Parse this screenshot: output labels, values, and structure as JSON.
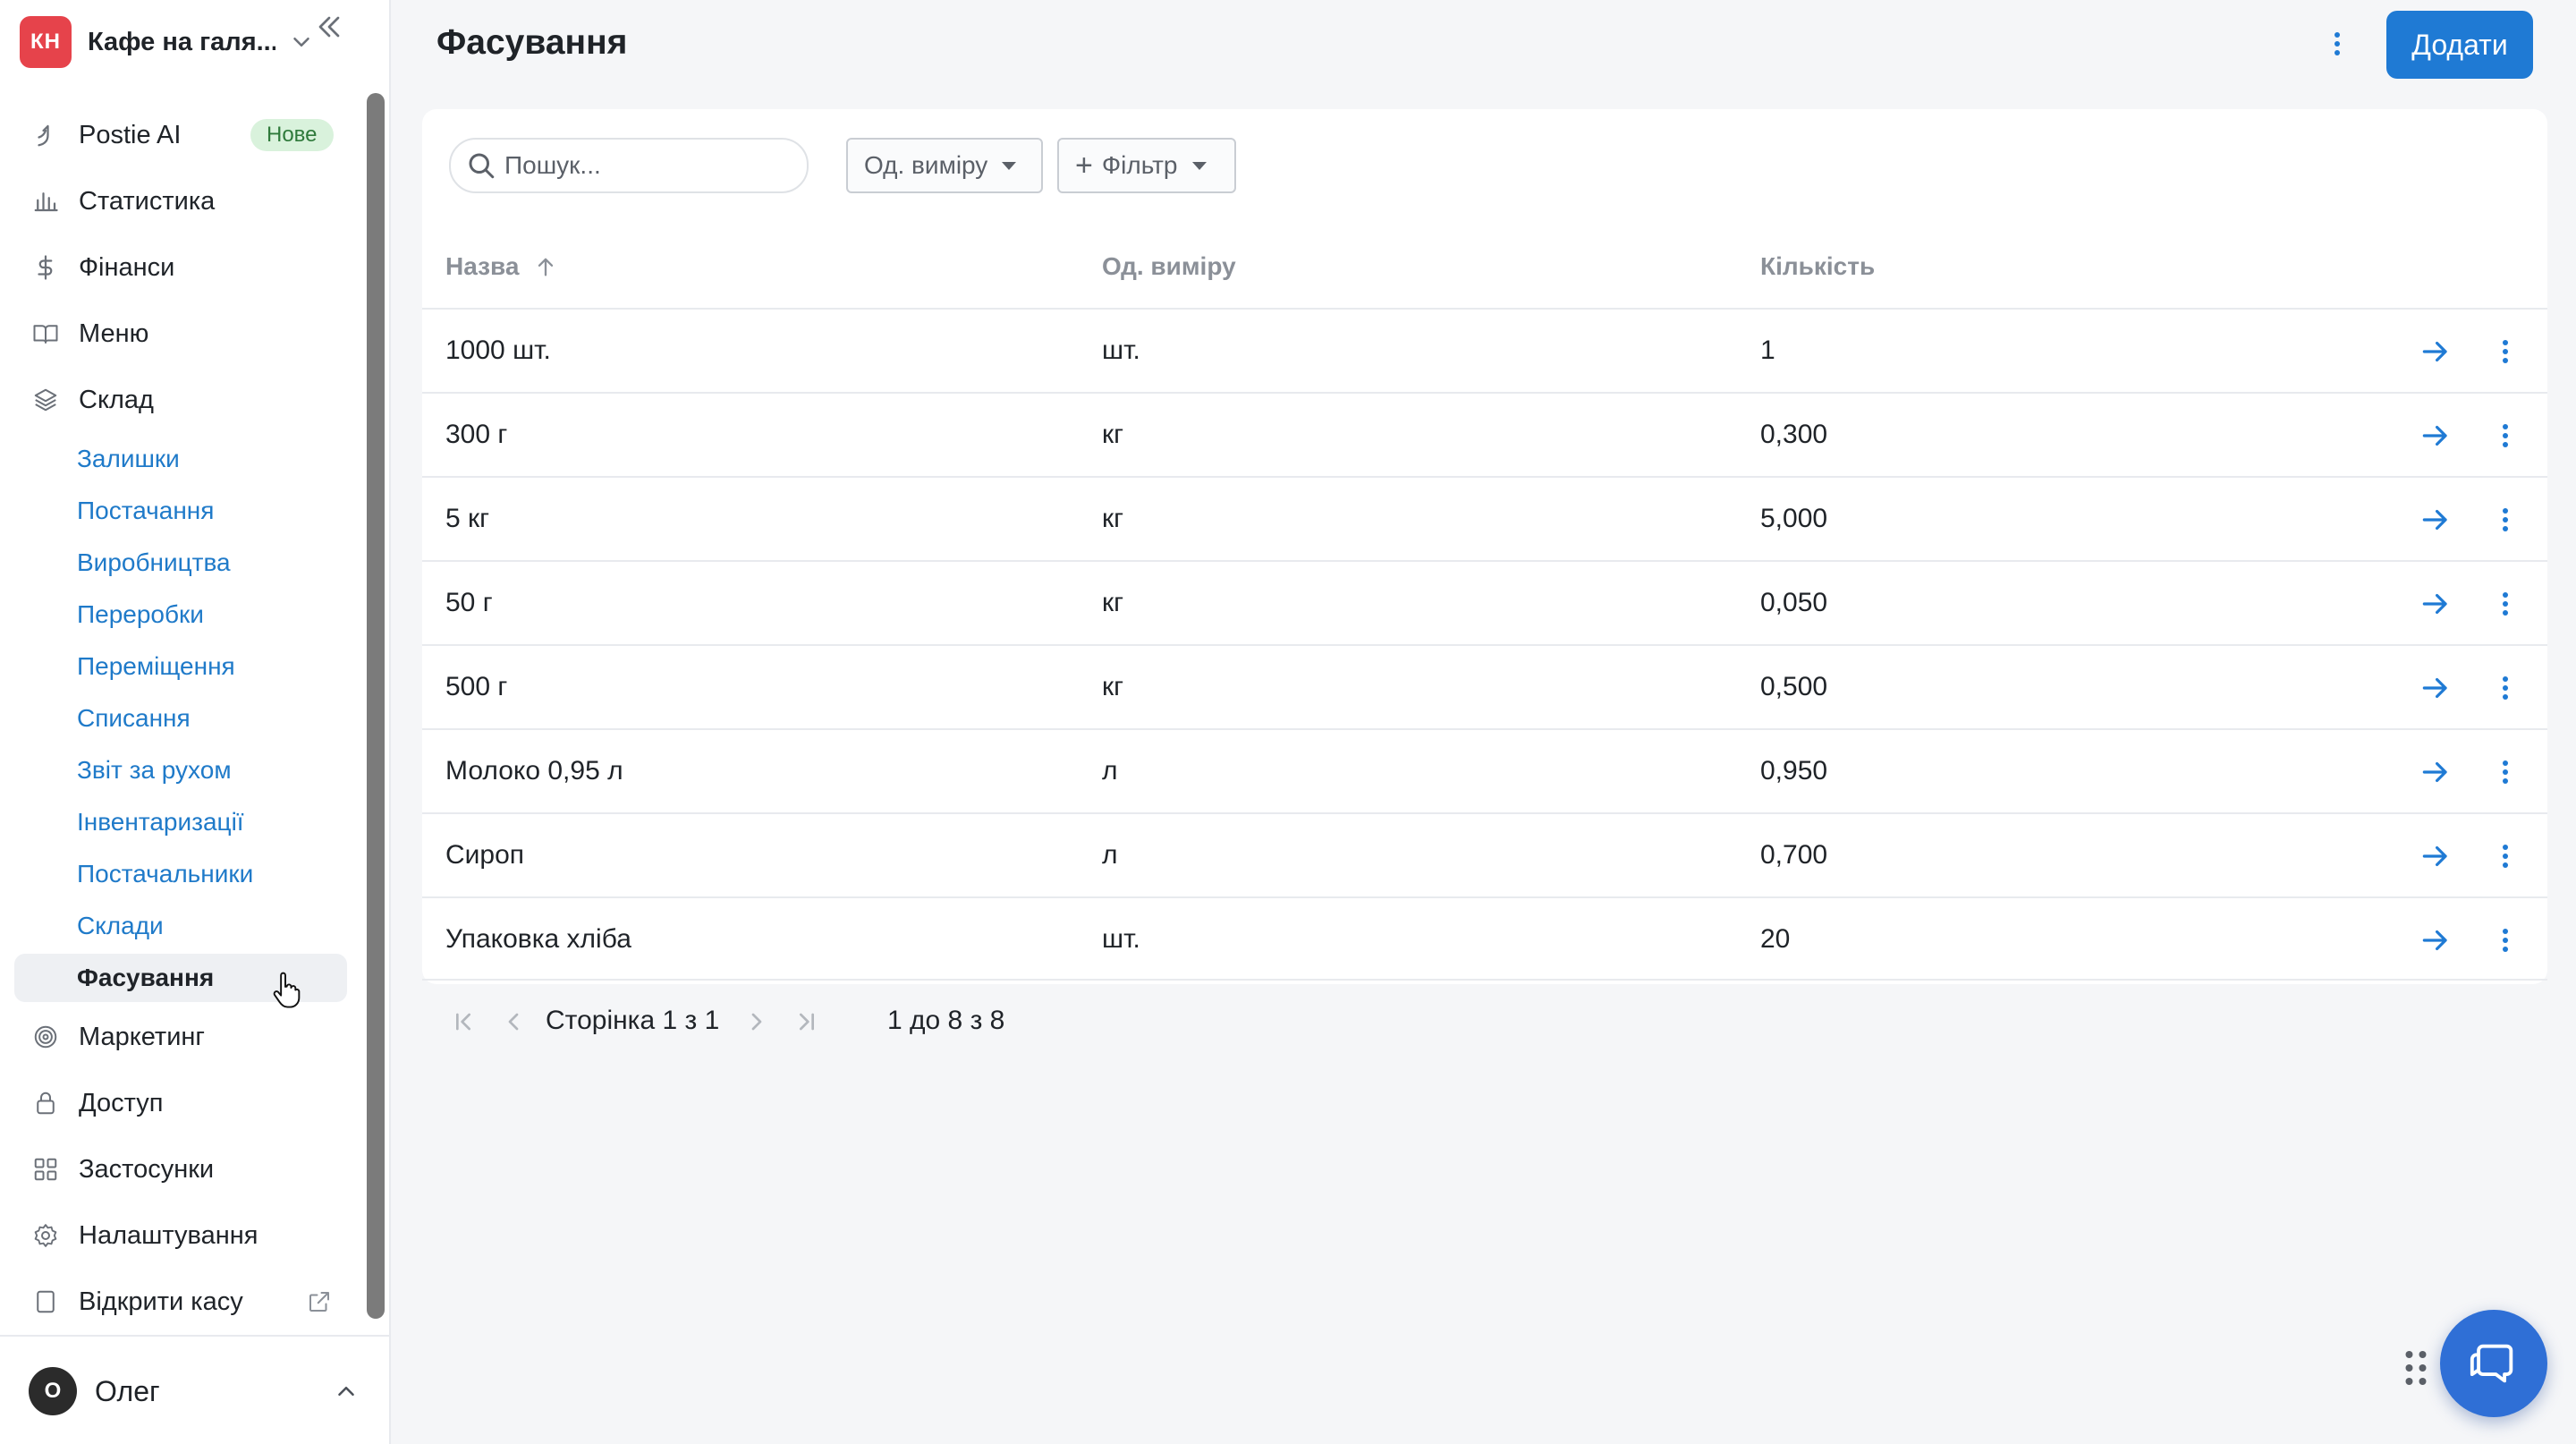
{
  "brand": {
    "initials": "КН",
    "name": "Кафе на галя..."
  },
  "nav": {
    "postie": {
      "label": "Postie AI",
      "badge": "Нове"
    },
    "stats": "Статистика",
    "finance": "Фінанси",
    "menu": "Меню",
    "warehouse": "Склад",
    "sub_items": [
      "Залишки",
      "Постачання",
      "Виробництва",
      "Переробки",
      "Переміщення",
      "Списання",
      "Звіт за рухом",
      "Інвентаризації",
      "Постачальники",
      "Склади",
      "Фасування"
    ],
    "marketing": "Маркетинг",
    "access": "Доступ",
    "apps": "Застосунки",
    "settings": "Налаштування",
    "open_register": "Відкрити касу"
  },
  "user": {
    "initial": "О",
    "name": "Олег"
  },
  "page": {
    "title": "Фасування",
    "add_label": "Додати"
  },
  "toolbar": {
    "search_placeholder": "Пошук...",
    "unit_filter": "Од. виміру",
    "filter_label": "Фільтр"
  },
  "table": {
    "headers": {
      "name": "Назва",
      "unit": "Од. виміру",
      "qty": "Кількість"
    },
    "rows": [
      {
        "name": "1000 шт.",
        "unit": "шт.",
        "qty": "1"
      },
      {
        "name": "300 г",
        "unit": "кг",
        "qty": "0,300"
      },
      {
        "name": "5 кг",
        "unit": "кг",
        "qty": "5,000"
      },
      {
        "name": "50 г",
        "unit": "кг",
        "qty": "0,050"
      },
      {
        "name": "500 г",
        "unit": "кг",
        "qty": "0,500"
      },
      {
        "name": "Молоко 0,95 л",
        "unit": "л",
        "qty": "0,950"
      },
      {
        "name": "Сироп",
        "unit": "л",
        "qty": "0,700"
      },
      {
        "name": "Упаковка хліба",
        "unit": "шт.",
        "qty": "20"
      }
    ]
  },
  "pagination": {
    "page_text": "Сторінка 1 з 1",
    "range_text": "1 до 8 з 8"
  },
  "colors": {
    "accent": "#1f7ad4",
    "link": "#1f7ac9",
    "brand_badge": "#e6434b",
    "chat": "#2f6fd6"
  }
}
